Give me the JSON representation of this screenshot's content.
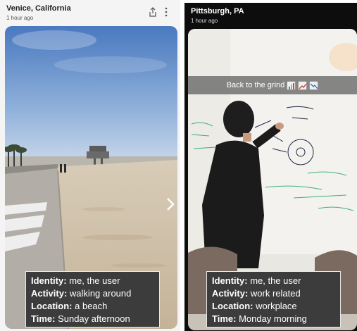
{
  "left_story": {
    "location": "Venice, California",
    "time_ago": "1 hour ago",
    "icons": {
      "share": "share-icon",
      "more": "more-vertical-icon",
      "next": "chevron-right-icon"
    },
    "info": [
      {
        "label": "Identity:",
        "value": "me, the user"
      },
      {
        "label": "Activity:",
        "value": "walking around"
      },
      {
        "label": "Location:",
        "value": "a beach"
      },
      {
        "label": "Time:",
        "value": "Sunday afternoon"
      }
    ]
  },
  "right_story": {
    "location": "Pittsburgh, PA",
    "time_ago": "1 hour ago",
    "caption": "Back to the grind",
    "caption_emojis": [
      "bar-chart-icon",
      "chart-increasing-icon",
      "chart-decreasing-icon"
    ],
    "info": [
      {
        "label": "Identity:",
        "value": "me, the user"
      },
      {
        "label": "Activity:",
        "value": "work related"
      },
      {
        "label": "Location:",
        "value": "workplace"
      },
      {
        "label": "Time:",
        "value": "Monday morning"
      }
    ]
  },
  "colors": {
    "overlay_bg": "#3c3c3c",
    "overlay_border": "#e8e8e8",
    "dark_panel": "#0d0d0d",
    "light_panel": "#f4f4f4"
  }
}
